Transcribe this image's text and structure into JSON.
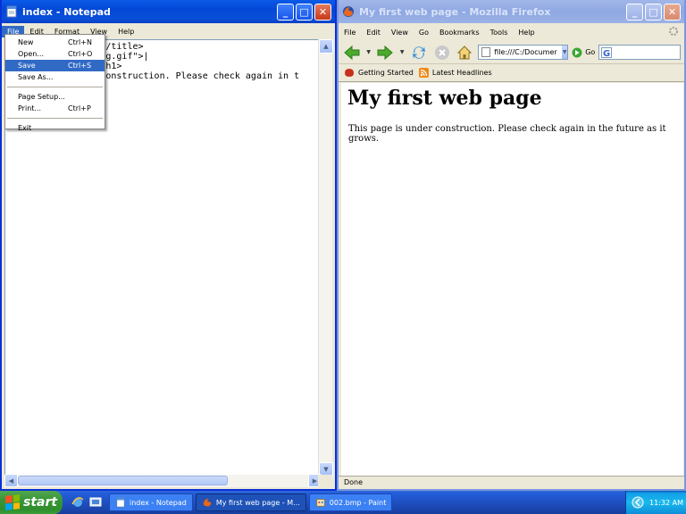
{
  "notepad": {
    "title": "index - Notepad",
    "menu": [
      "File",
      "Edit",
      "Format",
      "View",
      "Help"
    ],
    "text_lines": [
      "",
      "             page</title>",
      "",
      "",
      "",
      "             s-flag.gif\">|",
      "             age</h1>",
      "             der construction. Please check again in t",
      "  ...."
    ],
    "file_menu": {
      "items": [
        {
          "label": "New",
          "shortcut": "Ctrl+N"
        },
        {
          "label": "Open...",
          "shortcut": "Ctrl+O"
        },
        {
          "label": "Save",
          "shortcut": "Ctrl+S"
        },
        {
          "label": "Save As...",
          "shortcut": ""
        },
        {
          "label": "Page Setup...",
          "shortcut": ""
        },
        {
          "label": "Print...",
          "shortcut": "Ctrl+P"
        },
        {
          "label": "Exit",
          "shortcut": ""
        }
      ],
      "highlighted": "Save"
    }
  },
  "firefox": {
    "title": "My first web page - Mozilla Firefox",
    "menu": [
      "File",
      "Edit",
      "View",
      "Go",
      "Bookmarks",
      "Tools",
      "Help"
    ],
    "address": "file:///C:/Documer",
    "go_label": "Go",
    "bookmarks": [
      "Getting Started",
      "Latest Headlines"
    ],
    "page": {
      "heading": "My first web page",
      "paragraph": "This page is under construction. Please check again in the future as it grows."
    },
    "status": "Done"
  },
  "taskbar": {
    "start_label": "start",
    "tasks": [
      "index - Notepad",
      "My first web page - M...",
      "002.bmp - Paint"
    ],
    "active_task": "My first web page - M...",
    "clock": "11:32 AM"
  },
  "colors": {
    "xp_blue_title": "#0a5be8",
    "highlight": "#316ac5",
    "start_green": "#389637",
    "desktop": "#3a6ea5"
  }
}
